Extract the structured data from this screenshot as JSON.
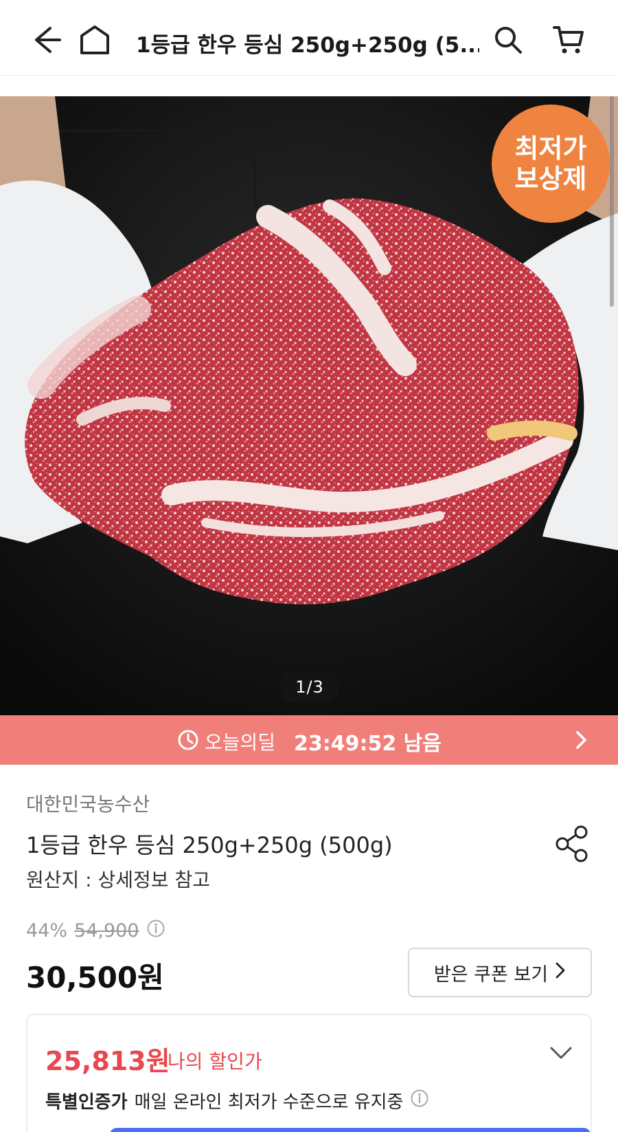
{
  "header": {
    "title": "1등급 한우 등심 250g+250g (5...",
    "icons": [
      "back-arrow-icon",
      "home-icon",
      "search-icon",
      "cart-icon"
    ]
  },
  "hero": {
    "badge_line1": "최저가",
    "badge_line2": "보상제",
    "counter": "1/3",
    "badge_color": "#ef8440"
  },
  "deal": {
    "label": "오늘의딜",
    "time": "23:49:52 남음",
    "color": "#f07f7a"
  },
  "product": {
    "seller": "대한민국농수산",
    "title": "1등급 한우 등심 250g+250g (500g)",
    "origin": "원산지 : 상세정보 참고",
    "discount": "44%",
    "original_price": "54,900",
    "price": "30,500원",
    "coupon_button": "받은 쿠폰 보기"
  },
  "my_price": {
    "price": "25,813원",
    "label": "나의 할인가",
    "note_strong": "특별인증가",
    "note_text": "매일 온라인 최저가 수준으로 유지중",
    "accent": "#e8474f"
  }
}
